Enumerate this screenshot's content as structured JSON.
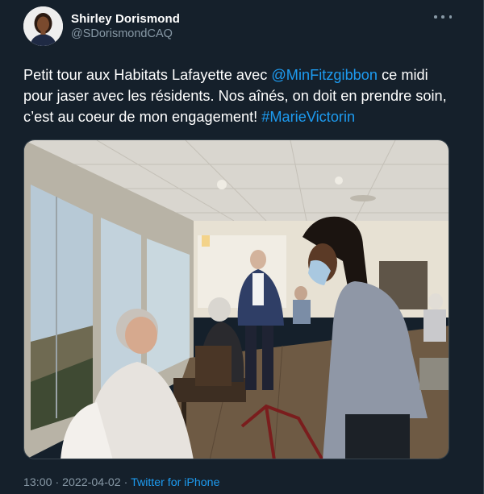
{
  "author": {
    "display_name": "Shirley Dorismond",
    "handle": "@SDorismondCAQ"
  },
  "tweet": {
    "text_1": "Petit tour aux Habitats Lafayette avec ",
    "mention": "@MinFitzgibbon",
    "text_2": " ce midi pour jaser avec les résidents. Nos aînés, on doit en prendre soin, c’est au coeur de mon engagement! ",
    "hashtag": "#MarieVictorin"
  },
  "meta": {
    "time": "13:00",
    "separator_1": " · ",
    "date": "2022-04-02",
    "separator_2": " · ",
    "source": "Twitter for iPhone"
  },
  "colors": {
    "background": "#15202b",
    "link": "#1d9bf0",
    "secondary_text": "#8899a6",
    "border": "#38444d"
  },
  "icons": {
    "more": "more-horizontal-icon"
  }
}
